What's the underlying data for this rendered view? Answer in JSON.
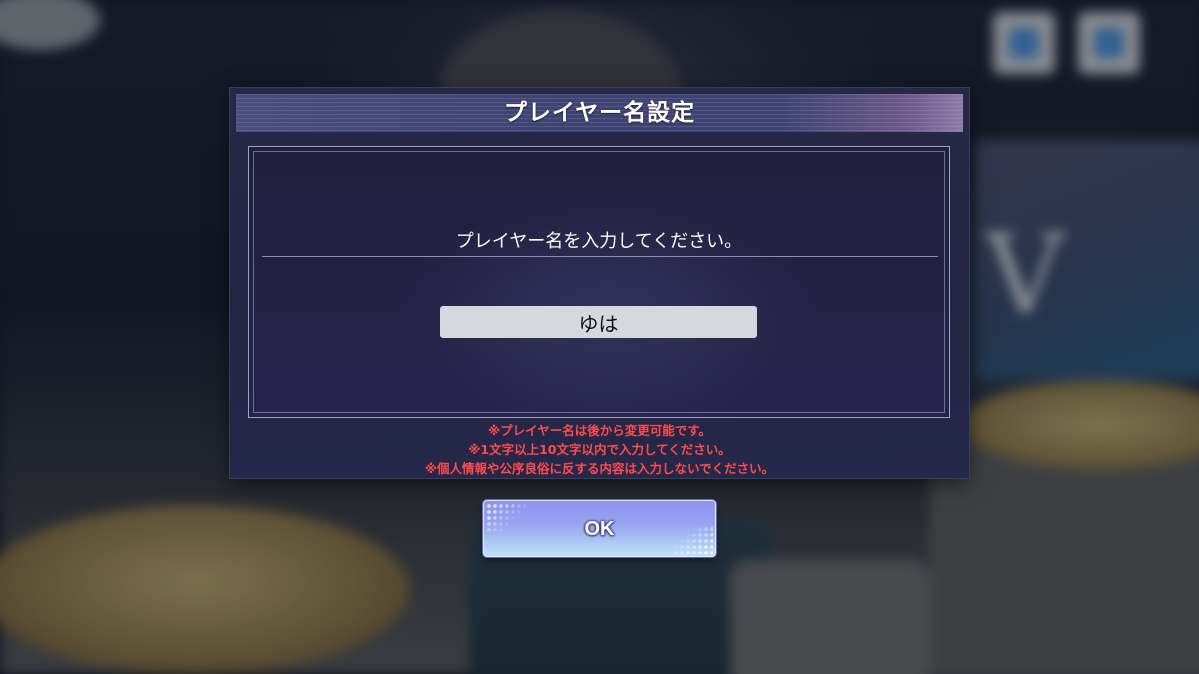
{
  "dialog": {
    "title": "プレイヤー名設定",
    "prompt": "プレイヤー名を入力してください。",
    "input_value": "ゆは",
    "notes": [
      "※プレイヤー名は後から変更可能です。",
      "※1文字以上10文字以内で入力してください。",
      "※個人情報や公序良俗に反する内容は入力しないでください。"
    ]
  },
  "ok_button": {
    "label": "OK"
  },
  "colors": {
    "note_text": "#ff4b4b",
    "ok_button_top": "#8c93ef",
    "ok_button_bottom": "#c4e0f6",
    "dialog_bg": "#252747"
  }
}
